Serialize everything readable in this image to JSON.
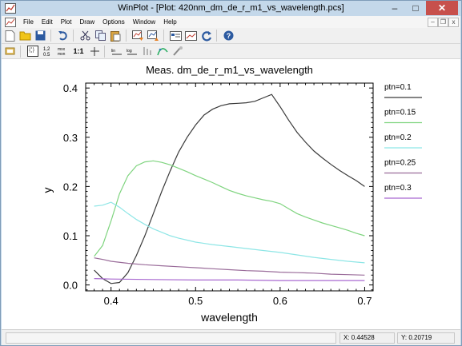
{
  "window": {
    "title": "WinPlot - [Plot: 420nm_dm_de_r_m1_vs_wavelength.pcs]",
    "minimize": "–",
    "maximize": "□",
    "close": "✕"
  },
  "menubar": {
    "items": [
      "File",
      "Edit",
      "Plot",
      "Draw",
      "Options",
      "Window",
      "Help"
    ],
    "mdi_min": "–",
    "mdi_restore": "❐",
    "mdi_close": "x"
  },
  "toolbar1": {
    "icons": [
      "new-icon",
      "open-icon",
      "save-icon",
      "undo-icon",
      "cut-icon",
      "copy-icon",
      "paste-icon",
      "plot-import-icon",
      "plot-export-icon",
      "chart-icon",
      "image-icon",
      "refresh-icon",
      "help-icon"
    ]
  },
  "toolbar2": {
    "icons": [
      "pointer-icon",
      "zoom-box-icon",
      "zoom-numbers-icon",
      "zoom-labels-icon",
      "ratio-icon",
      "axes-icon",
      "lin-icon",
      "log-icon",
      "bars-icon",
      "curve-icon",
      "tool-icon"
    ],
    "ratio_label": "1:1"
  },
  "status": {
    "message": "",
    "x": "X: 0.44528",
    "y": "Y: 0.20719"
  },
  "chart_data": {
    "type": "line",
    "title": "Meas. dm_de_r_m1_vs_wavelength",
    "xlabel": "wavelength",
    "ylabel": "y",
    "xlim": [
      0.37,
      0.71
    ],
    "ylim": [
      -0.012,
      0.41
    ],
    "xticks": [
      "0.4",
      "0.5",
      "0.6",
      "0.7"
    ],
    "yticks": [
      "0.0",
      "0.1",
      "0.2",
      "0.3",
      "0.4"
    ],
    "legend_position": "right",
    "series": [
      {
        "name": "ptn=0.1",
        "color": "#3a3a3a",
        "x": [
          0.38,
          0.39,
          0.4,
          0.41,
          0.42,
          0.43,
          0.44,
          0.45,
          0.46,
          0.47,
          0.48,
          0.49,
          0.5,
          0.51,
          0.52,
          0.53,
          0.54,
          0.55,
          0.56,
          0.57,
          0.58,
          0.59,
          0.6,
          0.61,
          0.62,
          0.63,
          0.64,
          0.65,
          0.66,
          0.67,
          0.68,
          0.69,
          0.7
        ],
        "y": [
          0.03,
          0.013,
          0.003,
          0.005,
          0.025,
          0.06,
          0.1,
          0.145,
          0.19,
          0.232,
          0.27,
          0.3,
          0.325,
          0.345,
          0.357,
          0.364,
          0.368,
          0.369,
          0.37,
          0.373,
          0.38,
          0.387,
          0.362,
          0.335,
          0.31,
          0.29,
          0.272,
          0.258,
          0.245,
          0.233,
          0.222,
          0.212,
          0.2
        ]
      },
      {
        "name": "ptn=0.15",
        "color": "#7fd47f",
        "x": [
          0.38,
          0.39,
          0.4,
          0.41,
          0.42,
          0.43,
          0.44,
          0.45,
          0.46,
          0.47,
          0.48,
          0.49,
          0.5,
          0.51,
          0.52,
          0.53,
          0.54,
          0.55,
          0.56,
          0.57,
          0.58,
          0.59,
          0.6,
          0.61,
          0.62,
          0.63,
          0.64,
          0.65,
          0.66,
          0.67,
          0.68,
          0.69,
          0.7
        ],
        "y": [
          0.058,
          0.08,
          0.13,
          0.185,
          0.222,
          0.242,
          0.25,
          0.252,
          0.249,
          0.244,
          0.237,
          0.23,
          0.222,
          0.215,
          0.208,
          0.2,
          0.192,
          0.186,
          0.181,
          0.177,
          0.173,
          0.17,
          0.165,
          0.155,
          0.145,
          0.138,
          0.132,
          0.126,
          0.121,
          0.116,
          0.111,
          0.105,
          0.1
        ]
      },
      {
        "name": "ptn=0.2",
        "color": "#8ee6e6",
        "x": [
          0.38,
          0.39,
          0.4,
          0.41,
          0.42,
          0.43,
          0.44,
          0.45,
          0.46,
          0.47,
          0.48,
          0.49,
          0.5,
          0.52,
          0.54,
          0.56,
          0.58,
          0.6,
          0.62,
          0.64,
          0.66,
          0.68,
          0.7
        ],
        "y": [
          0.16,
          0.162,
          0.168,
          0.158,
          0.145,
          0.133,
          0.123,
          0.114,
          0.107,
          0.1,
          0.095,
          0.091,
          0.087,
          0.082,
          0.078,
          0.074,
          0.07,
          0.066,
          0.061,
          0.056,
          0.052,
          0.048,
          0.045
        ]
      },
      {
        "name": "ptn=0.25",
        "color": "#9a6c9a",
        "x": [
          0.38,
          0.39,
          0.4,
          0.42,
          0.44,
          0.46,
          0.48,
          0.5,
          0.52,
          0.54,
          0.56,
          0.58,
          0.6,
          0.62,
          0.64,
          0.66,
          0.68,
          0.7
        ],
        "y": [
          0.055,
          0.052,
          0.048,
          0.044,
          0.041,
          0.039,
          0.037,
          0.035,
          0.033,
          0.031,
          0.029,
          0.028,
          0.026,
          0.025,
          0.024,
          0.022,
          0.021,
          0.02
        ]
      },
      {
        "name": "ptn=0.3",
        "color": "#a868d0",
        "x": [
          0.38,
          0.4,
          0.45,
          0.5,
          0.55,
          0.6,
          0.65,
          0.7
        ],
        "y": [
          0.013,
          0.012,
          0.011,
          0.01,
          0.01,
          0.009,
          0.009,
          0.009
        ]
      }
    ]
  }
}
